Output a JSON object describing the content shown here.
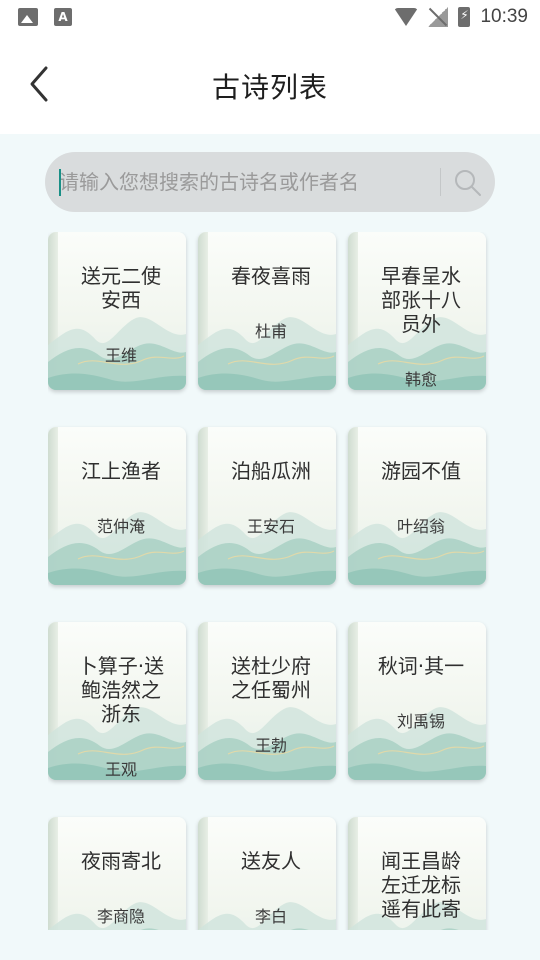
{
  "status_bar": {
    "time": "10:39",
    "left_icons": [
      "image-icon",
      "text-a-icon"
    ],
    "right_icons": [
      "wifi-icon",
      "no-sim-icon",
      "battery-charging-icon"
    ],
    "text_a": "A"
  },
  "header": {
    "title": "古诗列表",
    "back_icon": "chevron-left-icon"
  },
  "search": {
    "placeholder": "请输入您想搜索的古诗名或作者名",
    "value": "",
    "icon": "search-icon"
  },
  "colors": {
    "background": "#f1f9fa",
    "search_bg": "#d9dcdd",
    "caret": "#1a8f86",
    "card_mountain": "#a9d0c4"
  },
  "poems": [
    {
      "title": "送元二使安西",
      "author": "王维"
    },
    {
      "title": "春夜喜雨",
      "author": "杜甫"
    },
    {
      "title": "早春呈水部张十八员外",
      "author": "韩愈"
    },
    {
      "title": "江上渔者",
      "author": "范仲淹"
    },
    {
      "title": "泊船瓜洲",
      "author": "王安石"
    },
    {
      "title": "游园不值",
      "author": "叶绍翁"
    },
    {
      "title": "卜算子·送鲍浩然之浙东",
      "author": "王观"
    },
    {
      "title": "送杜少府之任蜀州",
      "author": "王勃"
    },
    {
      "title": "秋词·其一",
      "author": "刘禹锡"
    },
    {
      "title": "夜雨寄北",
      "author": "李商隐"
    },
    {
      "title": "送友人",
      "author": "李白"
    },
    {
      "title": "闻王昌龄左迁龙标遥有此寄",
      "author": ""
    }
  ]
}
